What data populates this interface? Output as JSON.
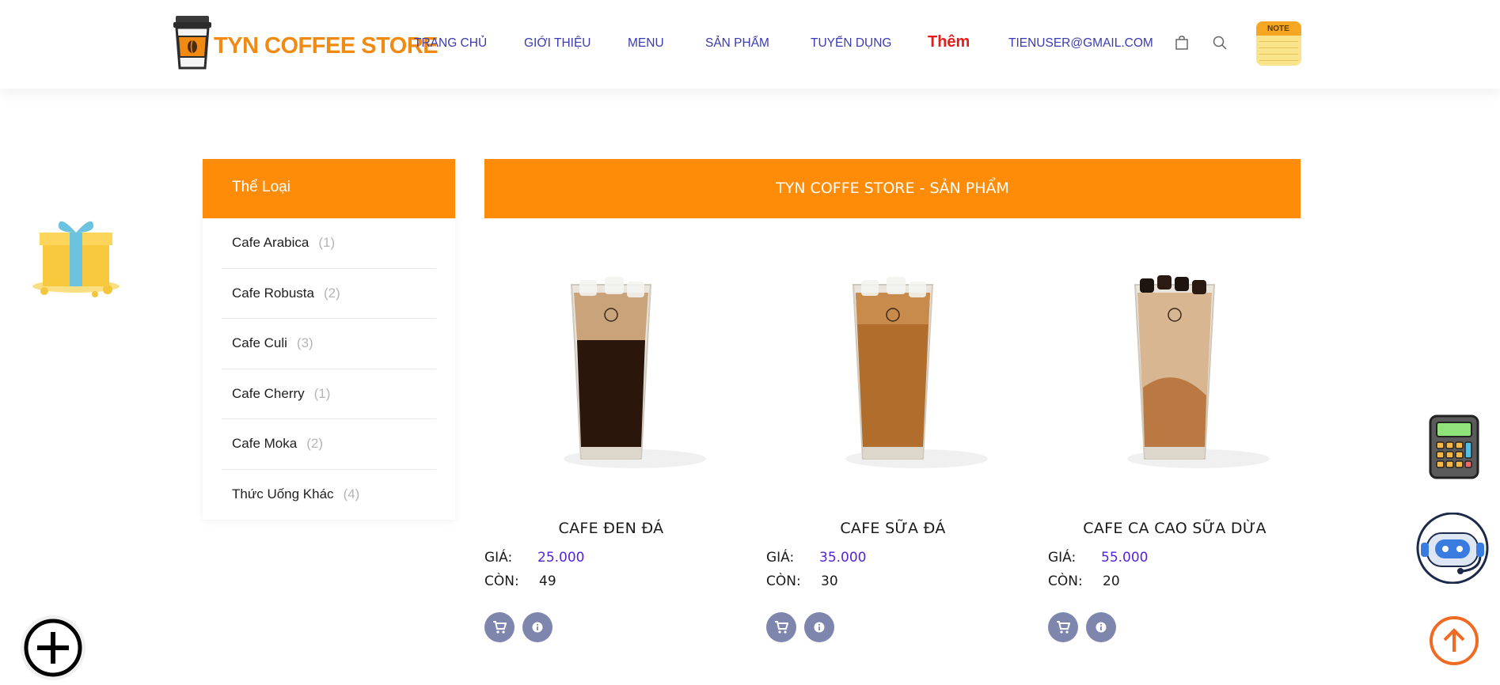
{
  "header": {
    "logo_text": "TYN COFFEE STORE",
    "nav": [
      {
        "label": "TRANG CHỦ"
      },
      {
        "label": "GIỚI THIỆU"
      },
      {
        "label": "MENU"
      },
      {
        "label": "SẢN PHẨM"
      },
      {
        "label": "TUYỂN DỤNG"
      },
      {
        "label": "Thêm"
      },
      {
        "label": "TIENUSER@GMAIL.COM"
      }
    ],
    "note_label": "NOTE"
  },
  "sidebar": {
    "title": "Thể Loại",
    "categories": [
      {
        "name": "Cafe Arabica",
        "count": "(1)"
      },
      {
        "name": "Cafe Robusta",
        "count": "(2)"
      },
      {
        "name": "Cafe Culi",
        "count": "(3)"
      },
      {
        "name": "Cafe Cherry",
        "count": "(1)"
      },
      {
        "name": "Cafe Moka",
        "count": "(2)"
      },
      {
        "name": "Thức Uống Khác",
        "count": "(4)"
      }
    ]
  },
  "main": {
    "title": "TYN COFFE STORE - SẢN PHẨM",
    "price_label": "GIÁ:",
    "stock_label": "CÒN:",
    "products": [
      {
        "name": "CAFE ĐEN ĐÁ",
        "price": "25.000",
        "stock": "49"
      },
      {
        "name": "CAFE SỮA ĐÁ",
        "price": "35.000",
        "stock": "30"
      },
      {
        "name": "CAFE CA CAO SỮA DỪA",
        "price": "55.000",
        "stock": "20"
      }
    ]
  },
  "colors": {
    "accent": "#fe8c08",
    "nav_link": "#3a3ab3",
    "highlight": "#e81b1b",
    "price": "#5523d9",
    "button": "#7e86ad"
  },
  "icons": [
    "shopping-bag-icon",
    "search-icon",
    "note-icon",
    "gift-icon",
    "cart-icon",
    "info-icon",
    "calculator-icon",
    "chatbot-icon",
    "arrow-up-icon",
    "plus-icon"
  ]
}
